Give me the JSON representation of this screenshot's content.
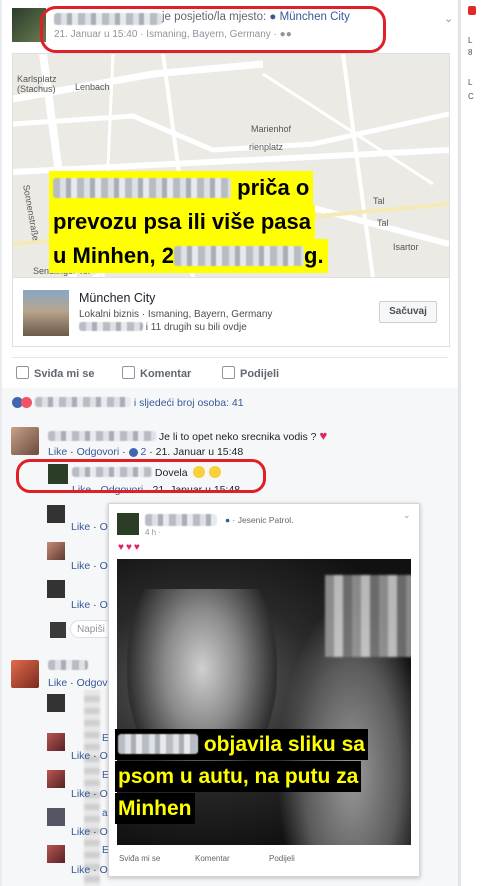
{
  "header": {
    "action_text": "je posjetio/la mjesto:",
    "place": "München City",
    "meta": "21. Januar u 15:40 · Ismaning, Bayern, Germany ·"
  },
  "map": {
    "labels": [
      "Lenbach",
      "Karlsplatz (Stachus)",
      "Marienhof",
      "rienplatz",
      "Sonnenstraße",
      "Tal",
      "Tal",
      "Isartor",
      "Sendlinger Tor"
    ],
    "overlay_lines": [
      "priča o",
      "prevozu psa ili više pasa",
      "u Minhen, 2",
      "g."
    ]
  },
  "place_card": {
    "name": "München City",
    "type": "Lokalni biznis · Ismaning, Bayern, Germany",
    "visitors": "i 11 drugih su bili ovdje",
    "save_label": "Sačuvaj"
  },
  "actions": {
    "like": "Sviđa mi se",
    "comment": "Komentar",
    "share": "Podijeli"
  },
  "reactions": {
    "text": "i sljedeći broj osoba: 41"
  },
  "comment1": {
    "text": "Je li to opet neko srecnika vodis ?",
    "like": "Like",
    "reply": "Odgovori",
    "count": "2",
    "time": "· 21. Januar u 15:48"
  },
  "comment2": {
    "text": "Dovela",
    "like": "Like",
    "reply": "Odgovori",
    "time": "· 21. Januar u 15:48"
  },
  "thread": {
    "like": "Like",
    "reply_short": "O",
    "odg": "Odgov",
    "write_placeholder": "Napiši"
  },
  "embedded": {
    "location": "· Jesenic Patrol.",
    "meta": "4 h · ",
    "hearts": "♥♥♥",
    "overlay_lines": [
      "objavila sliku sa",
      "psom u autu, na putu za",
      "Minhen"
    ],
    "like": "Sviđa mi se",
    "comment": "Komentar",
    "share": "Podijeli"
  },
  "names": {
    "e1": "E",
    "e2": "E",
    "a1": "a",
    "e3": "E"
  },
  "rail": {
    "l1": "L",
    "l2": "8",
    "l3": "L",
    "l4": "C"
  },
  "colors": {
    "link": "#385898",
    "highlight_ring": "#e01f26",
    "overlay_yellow": "#ffff00"
  }
}
